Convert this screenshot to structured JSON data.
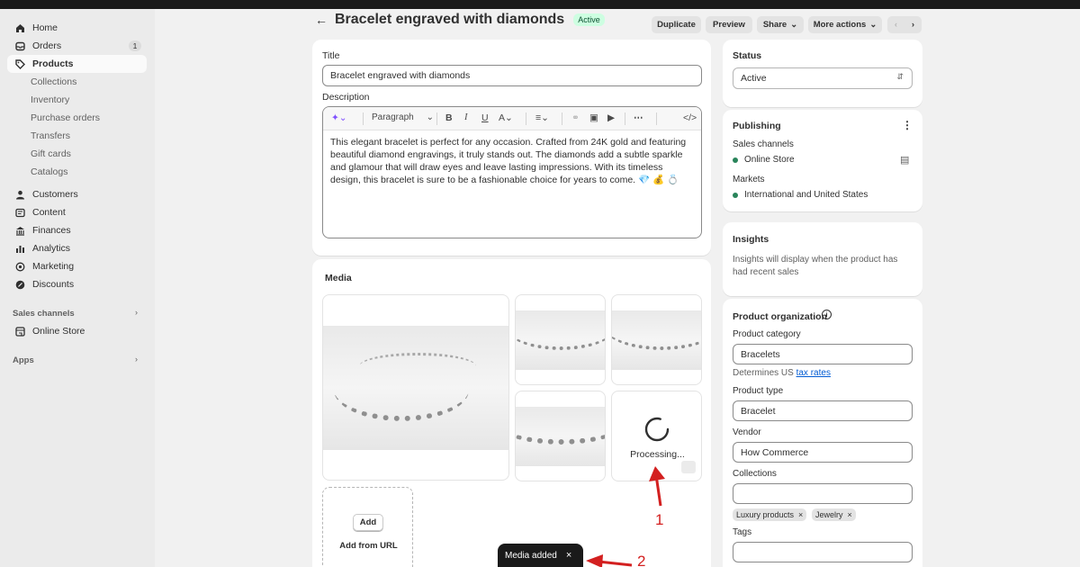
{
  "nav": {
    "home": "Home",
    "orders": "Orders",
    "orders_badge": "1",
    "products": "Products",
    "sub": [
      "Collections",
      "Inventory",
      "Purchase orders",
      "Transfers",
      "Gift cards",
      "Catalogs"
    ],
    "customers": "Customers",
    "content": "Content",
    "finances": "Finances",
    "analytics": "Analytics",
    "marketing": "Marketing",
    "discounts": "Discounts",
    "sales_channels": "Sales channels",
    "online_store": "Online Store",
    "apps": "Apps"
  },
  "header": {
    "title": "Bracelet engraved with diamonds",
    "status_badge": "Active",
    "duplicate": "Duplicate",
    "preview": "Preview",
    "share": "Share",
    "more_actions": "More actions"
  },
  "product": {
    "title_label": "Title",
    "title_value": "Bracelet engraved with diamonds",
    "description_label": "Description",
    "format_select": "Paragraph",
    "description": "This elegant bracelet is perfect for any occasion. Crafted from 24K gold and featuring beautiful diamond engravings, it truly stands out. The diamonds add a subtle sparkle and glamour that will draw eyes and leave lasting impressions. With its timeless design, this bracelet is sure to be a fashionable choice for years to come. 💎 💰 💍"
  },
  "media": {
    "title": "Media",
    "processing": "Processing...",
    "add_button": "Add",
    "add_from_url": "Add from URL"
  },
  "status": {
    "title": "Status",
    "value": "Active"
  },
  "publishing": {
    "title": "Publishing",
    "sales_channels_label": "Sales channels",
    "channel": "Online Store",
    "markets_label": "Markets",
    "market": "International and United States"
  },
  "insights": {
    "title": "Insights",
    "text": "Insights will display when the product has had recent sales"
  },
  "organization": {
    "title": "Product organization",
    "category_label": "Product category",
    "category_value": "Bracelets",
    "determines_text": "Determines US",
    "tax_link": "tax rates",
    "type_label": "Product type",
    "type_value": "Bracelet",
    "vendor_label": "Vendor",
    "vendor_value": "How Commerce",
    "collections_label": "Collections",
    "tags_collections": [
      "Luxury products",
      "Jewelry"
    ],
    "tags_label": "Tags"
  },
  "toast": {
    "text": "Media added"
  },
  "annotations": {
    "one": "1",
    "two": "2"
  },
  "colors": {
    "active_bg": "#cdfee1",
    "active_text": "#0c5132",
    "online_dot": "#29845a",
    "annotation": "#d32020",
    "link": "#005bd3"
  }
}
